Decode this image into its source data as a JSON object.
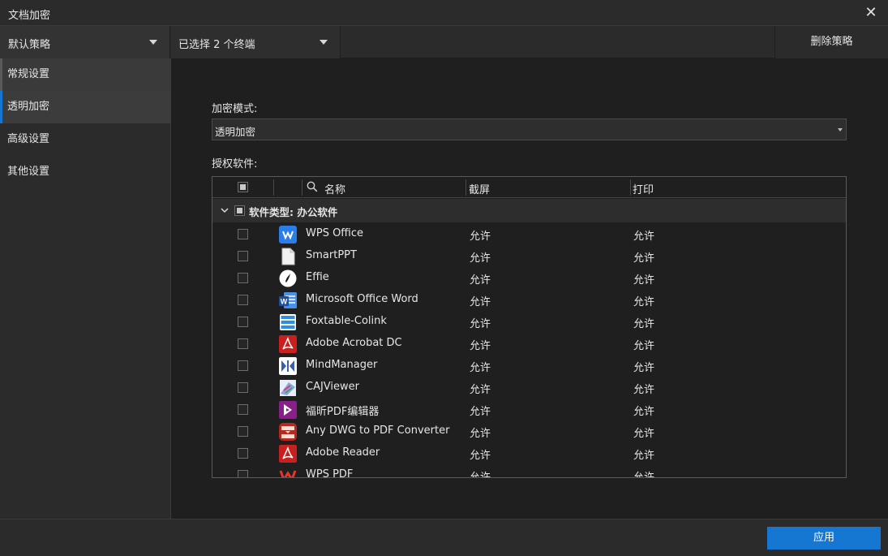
{
  "window": {
    "title": "文档加密",
    "close_glyph": "✕"
  },
  "toolbar": {
    "policy_value": "默认策略",
    "terminals_value": "已选择 2 个终端",
    "delete_label": "删除策略"
  },
  "sidebar": {
    "items": [
      {
        "label": "常规设置"
      },
      {
        "label": "透明加密"
      },
      {
        "label": "高级设置"
      },
      {
        "label": "其他设置"
      }
    ]
  },
  "main": {
    "mode_label": "加密模式:",
    "mode_value": "透明加密",
    "software_label": "授权软件:"
  },
  "table": {
    "headers": {
      "name": "名称",
      "screenshot": "截屏",
      "print": "打印"
    },
    "group": {
      "label": "软件类型: 办公软件"
    },
    "rows": [
      {
        "name": "WPS Office",
        "screenshot": "允许",
        "print": "允许",
        "icon": "wps-office-icon",
        "color": "#2b7de9"
      },
      {
        "name": "SmartPPT",
        "screenshot": "允许",
        "print": "允许",
        "icon": "document-file-icon",
        "color": "#f2f2f2"
      },
      {
        "name": "Effie",
        "screenshot": "允许",
        "print": "允许",
        "icon": "effie-icon",
        "color": "#ffffff"
      },
      {
        "name": "Microsoft Office Word",
        "screenshot": "允许",
        "print": "允许",
        "icon": "word-icon",
        "color": "#2b5fb8"
      },
      {
        "name": "Foxtable-Colink",
        "screenshot": "允许",
        "print": "允许",
        "icon": "foxtable-icon",
        "color": "#2f8de4"
      },
      {
        "name": "Adobe Acrobat DC",
        "screenshot": "允许",
        "print": "允许",
        "icon": "acrobat-icon",
        "color": "#c8201e"
      },
      {
        "name": "MindManager",
        "screenshot": "允许",
        "print": "允许",
        "icon": "mindmanager-icon",
        "color": "#3b5ea8"
      },
      {
        "name": "CAJViewer",
        "screenshot": "允许",
        "print": "允许",
        "icon": "cajviewer-icon",
        "color": "#8aa6d8"
      },
      {
        "name": "福昕PDF编辑器",
        "screenshot": "允许",
        "print": "允许",
        "icon": "foxit-pdf-icon",
        "color": "#8b1f8a"
      },
      {
        "name": "Any DWG to PDF Converter",
        "screenshot": "允许",
        "print": "允许",
        "icon": "dwg-pdf-icon",
        "color": "#b52a1e"
      },
      {
        "name": "Adobe Reader",
        "screenshot": "允许",
        "print": "允许",
        "icon": "adobe-reader-icon",
        "color": "#c8201e"
      },
      {
        "name": "WPS PDF",
        "screenshot": "允许",
        "print": "允许",
        "icon": "wps-pdf-icon",
        "color": "#e8352a"
      }
    ]
  },
  "footer": {
    "apply_label": "应用"
  },
  "colors": {
    "accent": "#1677d2",
    "background": "#2b2b2b",
    "panel": "#1f1f1f"
  }
}
